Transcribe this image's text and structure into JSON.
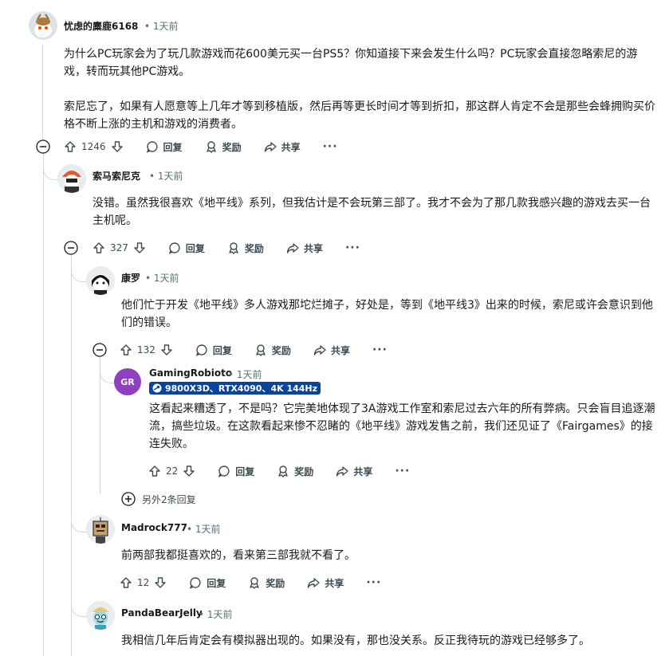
{
  "comments": [
    {
      "username": "忧虑的麋鹿6168",
      "time": "1天前",
      "body": [
        "为什么PC玩家会为了玩几款游戏而花600美元买一台PS5？你知道接下来会发生什么吗？PC玩家会直接忽略索尼的游戏，转而玩其他PC游戏。",
        "索尼忘了，如果有人愿意等上几年才等到移植版，然后再等更长时间才等到折扣，那这群人肯定不会是那些会蜂拥购买价格不断上涨的主机和游戏的消费者。"
      ],
      "votes": "1246"
    },
    {
      "username": "索马索尼克",
      "time": "1天前",
      "body": [
        "没错。虽然我很喜欢《地平线》系列，但我估计是不会玩第三部了。我才不会为了那几款我感兴趣的游戏去买一台主机呢。"
      ],
      "votes": "327"
    },
    {
      "username": "康罗",
      "time": "1天前",
      "body": [
        "他们忙于开发《地平线》多人游戏那坨烂摊子，好处是，等到《地平线3》出来的时候，索尼或许会意识到他们的错误。"
      ],
      "votes": "132"
    },
    {
      "username": "GamingRobioto",
      "time": "1天前",
      "avatar_text": "GR",
      "flair": "9800X3D、RTX4090、4K 144Hz",
      "body": [
        "这看起来糟透了，不是吗？它完美地体现了3A游戏工作室和索尼过去六年的所有弊病。只会盲目追逐潮流，搞些垃圾。在这款看起来惨不忍睹的《地平线》游戏发售之前，我们还见证了《Fairgames》的接连失败。"
      ],
      "votes": "22"
    },
    {
      "username": "Madrock777",
      "time": "1天前",
      "body": [
        "前两部我都挺喜欢的，看来第三部我就不看了。"
      ],
      "votes": "12"
    },
    {
      "username": "PandaBearJelly",
      "time": "1天前",
      "body": [
        "我相信几年后肯定会有模拟器出现的。如果没有，那也没关系。反正我待玩的游戏已经够多了。"
      ]
    }
  ],
  "actions": {
    "reply": "回复",
    "award": "奖励",
    "share": "共享",
    "more": "···"
  },
  "more_replies": "另外2条回复",
  "separator": "•",
  "colors": {
    "flair_bg": "#0a449b",
    "gr_avatar": "#8f3fbf",
    "line": "#d3d6da"
  }
}
